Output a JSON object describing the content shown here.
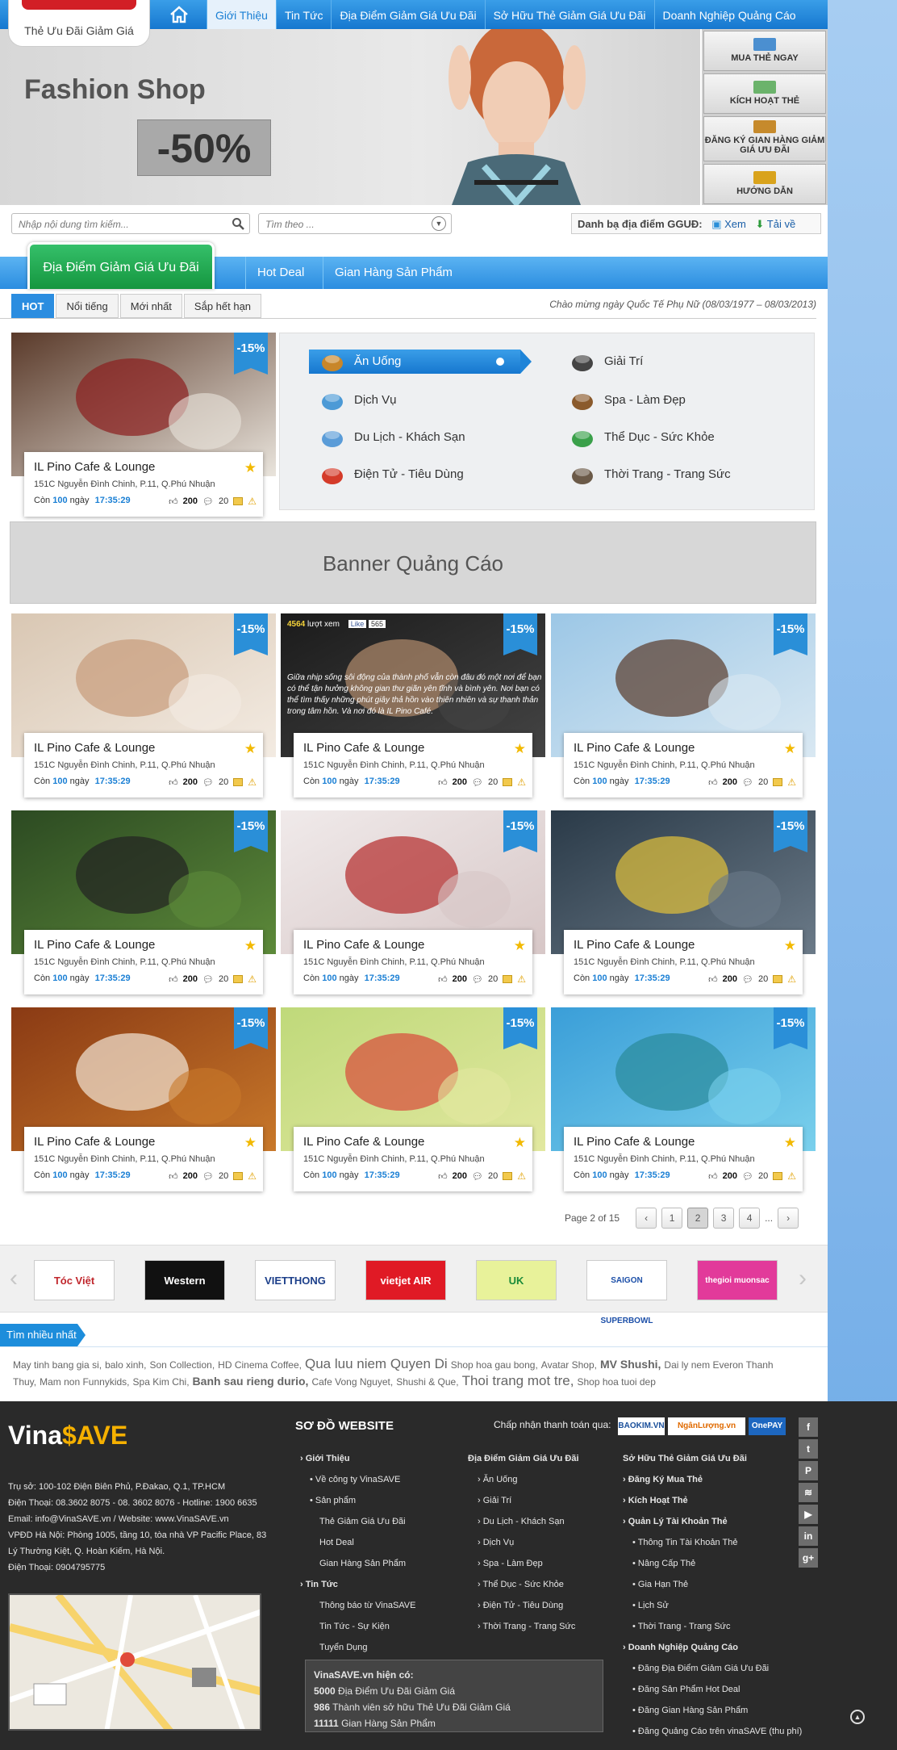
{
  "logo": {
    "text": "Thẻ Ưu Đãi Giảm Giá"
  },
  "nav": {
    "items": [
      {
        "label": "Giới Thiệu",
        "active": true
      },
      {
        "label": "Tin Tức"
      },
      {
        "label": "Địa Điểm Giảm Giá Ưu Đãi"
      },
      {
        "label": "Sở Hữu Thẻ Giảm Giá Ưu Đãi"
      },
      {
        "label": "Doanh Nghiệp Quảng Cáo"
      }
    ]
  },
  "hero": {
    "brand": "Fashion Shop",
    "promo": "-50%"
  },
  "side_buttons": [
    {
      "label": "MUA THẺ NGAY",
      "icon": "card-icon"
    },
    {
      "label": "KÍCH HOẠT THẺ",
      "icon": "lock-icon"
    },
    {
      "label": "ĐĂNG KÝ GIAN HÀNG GIẢM GIÁ ƯU ĐÃI",
      "icon": "box-icon"
    },
    {
      "label": "HƯỚNG DẪN",
      "icon": "pencil-icon"
    }
  ],
  "search": {
    "placeholder": "Nhập nội dung tìm kiếm...",
    "filter_placeholder": "Tìm theo ...",
    "directory_label": "Danh bạ địa điểm GGUĐ:",
    "view_label": "Xem",
    "download_label": "Tải về"
  },
  "category_tabs": {
    "active": "Địa Điểm Giảm Giá Ưu Đãi",
    "others": [
      "Hot Deal",
      "Gian Hàng Sản Phẩm"
    ]
  },
  "sub_tabs": [
    {
      "label": "HOT",
      "active": true
    },
    {
      "label": "Nổi tiếng"
    },
    {
      "label": "Mới nhất"
    },
    {
      "label": "Sắp hết hạn"
    }
  ],
  "welcome": "Chào mừng ngày Quốc Tế Phụ Nữ (08/03/1977 – 08/03/2013)",
  "categories": [
    {
      "label": "Ăn Uống",
      "icon": "food-icon",
      "selected": true
    },
    {
      "label": "Giải Trí",
      "icon": "bowling-icon"
    },
    {
      "label": "Dịch Vụ",
      "icon": "service-icon"
    },
    {
      "label": "Spa - Làm Đẹp",
      "icon": "spa-icon"
    },
    {
      "label": "Du Lịch - Khách Sạn",
      "icon": "plane-icon"
    },
    {
      "label": "Thể Dục - Sức Khỏe",
      "icon": "field-icon"
    },
    {
      "label": "Điện Tử - Tiêu Dùng",
      "icon": "bag-icon"
    },
    {
      "label": "Thời Trang - Trang Sức",
      "icon": "handbag-icon"
    }
  ],
  "ad_banner": "Banner Quảng Cáo",
  "deal": {
    "title": "IL Pino Cafe & Lounge",
    "address": "151C Nguyễn Đình Chinh, P.11, Q.Phú Nhuận",
    "remain_prefix": "Còn",
    "days": "100",
    "days_suffix": "ngày",
    "time": "17:35:29",
    "likes": "200",
    "comments": "20",
    "discount": "-15%"
  },
  "overlay_card": {
    "views": "4564",
    "views_suffix": "lượt xem",
    "like_label": "Like",
    "like_count": "565",
    "text": "Giữa nhịp sống sôi động của thành phố vẫn còn đâu đó một nơi để bạn có thể tận hưởng không gian thư giãn yên tĩnh và bình yên. Nơi bạn có thể tìm thấy những phút giây thả hồn vào thiên nhiên và sự thanh thản trong tâm hồn. Và nơi đó là IL Pino Café."
  },
  "pagination": {
    "label": "Page 2 of 15",
    "pages": [
      "1",
      "2",
      "3",
      "4"
    ],
    "current": "2",
    "ellipsis": "..."
  },
  "partners": [
    "Tóc Việt",
    "Western",
    "VIETTHONG",
    "vietjet AIR",
    "UK",
    "SAIGON SUPERBOWL",
    "thegioi muonsac"
  ],
  "popular": {
    "heading": "Tìm nhiều nhất",
    "terms": [
      {
        "text": "May tinh bang gia si,",
        "size": 12
      },
      {
        "text": "balo xinh,",
        "size": 12
      },
      {
        "text": "Son Collection,",
        "size": 12
      },
      {
        "text": "HD Cinema Coffee,",
        "size": 12
      },
      {
        "text": "Qua luu niem Quyen Di",
        "size": 17
      },
      {
        "text": "Shop hoa gau bong,",
        "size": 12
      },
      {
        "text": "Avatar Shop,",
        "size": 12
      },
      {
        "text": "MV Shushi,",
        "size": 14
      },
      {
        "text": "Dai ly nem Everon Thanh Thuy,",
        "size": 12
      },
      {
        "text": "Mam non Funnykids,",
        "size": 12
      },
      {
        "text": "Spa Kim Chi,",
        "size": 12
      },
      {
        "text": "Banh sau rieng durio,",
        "size": 14
      },
      {
        "text": "Cafe Vong Nguyet,",
        "size": 12
      },
      {
        "text": "Shushi & Que,",
        "size": 12
      },
      {
        "text": "Thoi trang mot tre,",
        "size": 17
      },
      {
        "text": "Shop hoa tuoi dep",
        "size": 12
      }
    ]
  },
  "footer": {
    "logo_a": "Vina",
    "logo_dollar": "$",
    "logo_b": "AVE",
    "contact": [
      "Trụ sở: 100-102 Điện Biên Phủ, P.Đakao, Q.1, TP.HCM",
      "Điện Thoại: 08.3602 8075 - 08. 3602 8076 - Hotline: 1900 6635",
      "Email: info@VinaSAVE.vn / Website: www.VinaSAVE.vn",
      "VPĐD Hà Nội: Phòng 1005, tầng 10, tòa nhà VP Pacific Place, 83",
      "Lý Thường Kiệt, Q. Hoàn Kiếm, Hà Nội.",
      "Điện Thoại: 0904795775"
    ],
    "sitemap_title": "SƠ ĐỒ WEBSITE",
    "payment_label": "Chấp nhận thanh toán qua:",
    "payment_logos": [
      "BAOKIM.VN",
      "NgânLượng.vn",
      "OnePAY"
    ],
    "col1": [
      {
        "text": "› Giới Thiệu",
        "bold": true,
        "indent": 0
      },
      {
        "text": "• Về công ty VinaSAVE",
        "indent": 1
      },
      {
        "text": "• Sản phẩm",
        "indent": 1
      },
      {
        "text": "Thẻ Giảm Giá Ưu Đãi",
        "indent": 2
      },
      {
        "text": "Hot Deal",
        "indent": 2
      },
      {
        "text": "Gian Hàng Sản Phẩm",
        "indent": 2
      },
      {
        "text": "› Tin Tức",
        "bold": true,
        "indent": 0
      },
      {
        "text": "Thông báo từ VinaSAVE",
        "indent": 2
      },
      {
        "text": "Tin Tức - Sự Kiện",
        "indent": 2
      },
      {
        "text": "Tuyển Dụng",
        "indent": 2
      }
    ],
    "col2": [
      {
        "text": "Địa Điểm Giảm Giá Ưu Đãi",
        "bold": true,
        "indent": 0
      },
      {
        "text": "› Ăn Uống",
        "indent": 1
      },
      {
        "text": "› Giải Trí",
        "indent": 1
      },
      {
        "text": "› Du Lịch - Khách Sạn",
        "indent": 1
      },
      {
        "text": "› Dịch Vụ",
        "indent": 1
      },
      {
        "text": "› Spa - Làm Đẹp",
        "indent": 1
      },
      {
        "text": "› Thể Dục - Sức Khỏe",
        "indent": 1
      },
      {
        "text": "› Điện Tử - Tiêu Dùng",
        "indent": 1
      },
      {
        "text": "› Thời Trang - Trang Sức",
        "indent": 1
      }
    ],
    "col3": [
      {
        "text": "Sở Hữu Thẻ Giảm Giá Ưu Đãi",
        "bold": true,
        "indent": 0
      },
      {
        "text": "› Đăng Ký Mua Thẻ",
        "bold": true,
        "indent": 0
      },
      {
        "text": "› Kích Hoạt Thẻ",
        "bold": true,
        "indent": 0
      },
      {
        "text": "› Quản Lý Tài Khoản Thẻ",
        "bold": true,
        "indent": 0
      },
      {
        "text": "• Thông Tin Tài Khoản Thẻ",
        "indent": 1
      },
      {
        "text": "• Nâng Cấp Thẻ",
        "indent": 1
      },
      {
        "text": "• Gia Hạn Thẻ",
        "indent": 1
      },
      {
        "text": "• Lịch Sử",
        "indent": 1
      },
      {
        "text": "• Thời Trang - Trang Sức",
        "indent": 1
      },
      {
        "text": "› Doanh Nghiệp Quảng Cáo",
        "bold": true,
        "indent": 0
      },
      {
        "text": "• Đăng Địa Điểm Giảm Giá Ưu Đãi",
        "indent": 1
      },
      {
        "text": "• Đăng Sản Phẩm Hot Deal",
        "indent": 1
      },
      {
        "text": "• Đăng Gian Hàng Sản Phẩm",
        "indent": 1
      },
      {
        "text": "• Đăng Quảng Cáo trên vinaSAVE (thu phí)",
        "indent": 1
      }
    ],
    "stats_title": "VinaSAVE.vn hiện có:",
    "stats": [
      {
        "num": "5000",
        "text": "Địa Điểm Ưu Đãi Giảm Giá"
      },
      {
        "num": "986",
        "text": "Thành viên sở hữu Thẻ Ưu Đãi Giảm Giá"
      },
      {
        "num": "11111",
        "text": "Gian Hàng Sản Phẩm"
      }
    ],
    "social": [
      {
        "label": "f",
        "icon": "facebook-icon"
      },
      {
        "label": "t",
        "icon": "twitter-icon"
      },
      {
        "label": "P",
        "icon": "pinterest-icon"
      },
      {
        "label": "≋",
        "icon": "rss-icon"
      },
      {
        "label": "▶",
        "icon": "youtube-icon"
      },
      {
        "label": "in",
        "icon": "linkedin-icon"
      },
      {
        "label": "g+",
        "icon": "googleplus-icon"
      }
    ]
  },
  "colors": {
    "primary": "#1d8ddb",
    "green": "#1ba74a",
    "badge": "#2a8fd8",
    "footer": "#2a2a2a",
    "star": "#f2b900"
  }
}
